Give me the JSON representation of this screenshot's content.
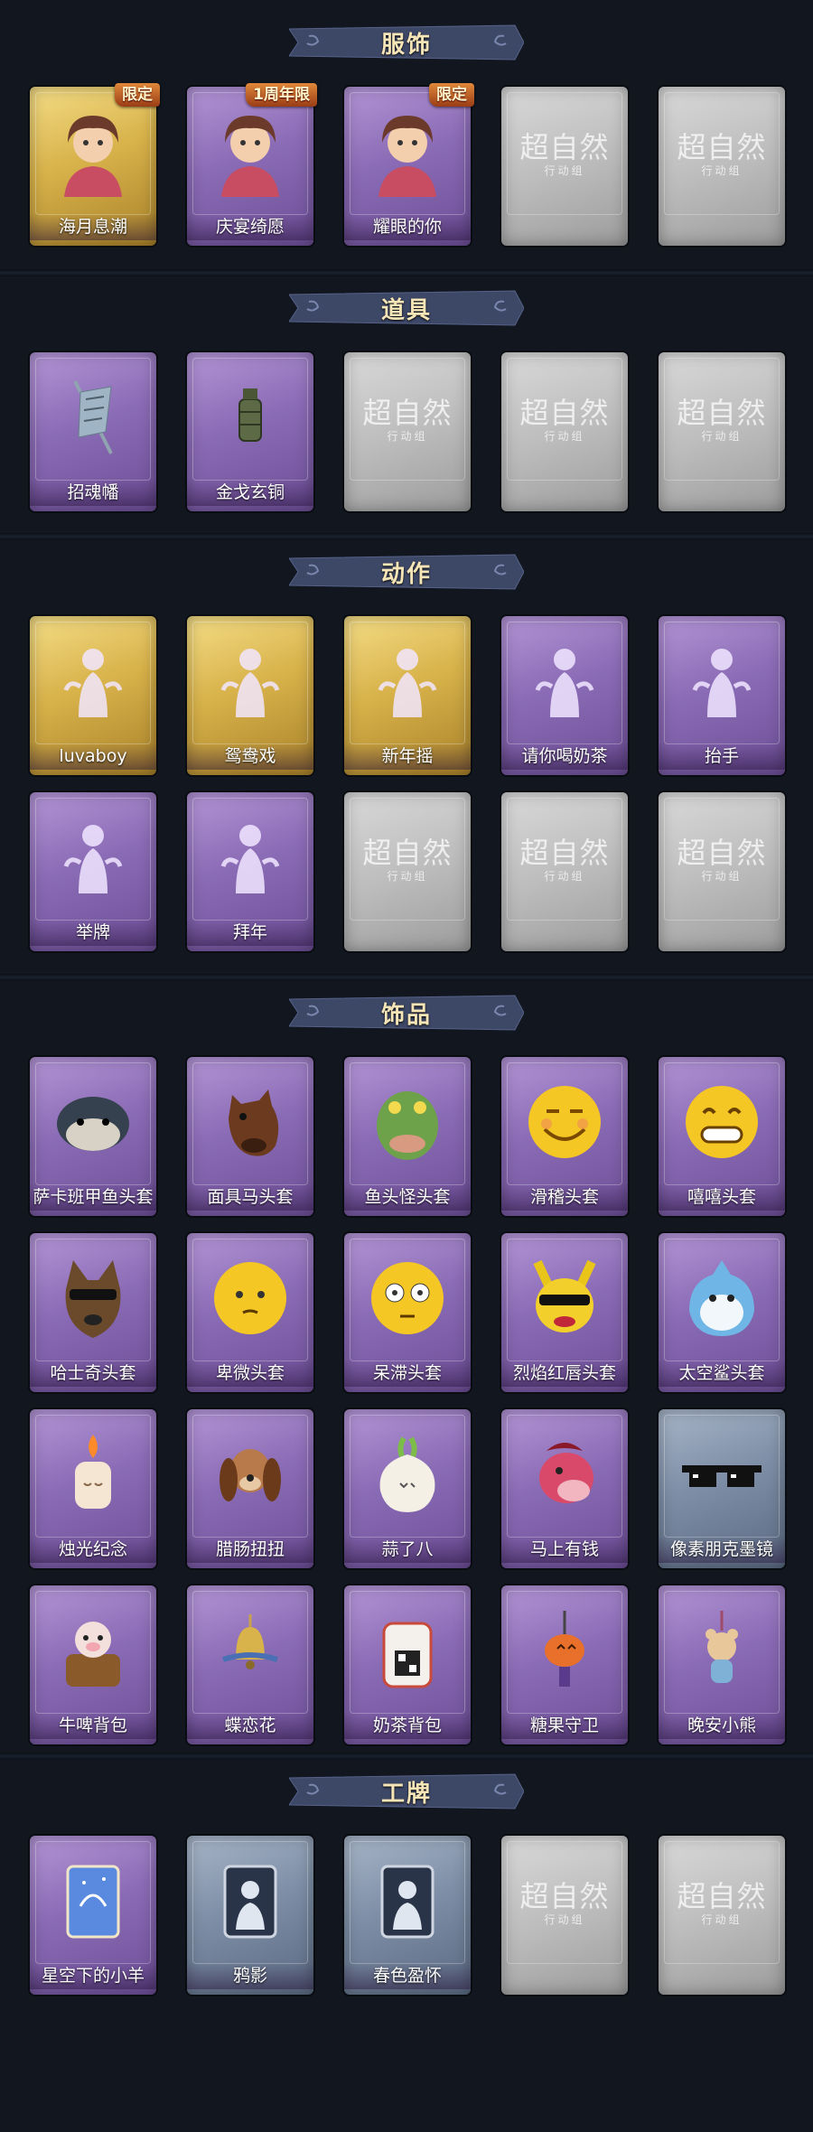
{
  "colors": {
    "background": "#11161f",
    "banner": "#3d4766",
    "banner_text": "#f6e6b7",
    "purple_frame": "#8a6bb5",
    "gold_frame": "#d8b24a",
    "blue_frame": "#7e8ea6",
    "grey_frame": "#bdbdbd",
    "badge": "#c2602a"
  },
  "placeholder": {
    "title": "超自然",
    "subtitle": "行动组"
  },
  "sections": [
    {
      "title": "服饰",
      "items": [
        {
          "label": "海月息潮",
          "style": "gold",
          "badge": "限定",
          "icon": "character-portrait-icon"
        },
        {
          "label": "庆宴绮愿",
          "style": "purple",
          "badge": "1周年限",
          "icon": "character-portrait-icon"
        },
        {
          "label": "耀眼的你",
          "style": "purple",
          "badge": "限定",
          "icon": "character-portrait-icon"
        },
        {
          "label": "",
          "style": "grey",
          "icon": "placeholder-logo-icon"
        },
        {
          "label": "",
          "style": "grey",
          "icon": "placeholder-logo-icon"
        }
      ]
    },
    {
      "title": "道具",
      "items": [
        {
          "label": "招魂幡",
          "style": "purple",
          "icon": "banner-prop-icon"
        },
        {
          "label": "金戈玄铜",
          "style": "purple",
          "icon": "bronze-lantern-icon"
        },
        {
          "label": "",
          "style": "grey",
          "icon": "placeholder-logo-icon"
        },
        {
          "label": "",
          "style": "grey",
          "icon": "placeholder-logo-icon"
        },
        {
          "label": "",
          "style": "grey",
          "icon": "placeholder-logo-icon"
        }
      ]
    },
    {
      "title": "动作",
      "items": [
        {
          "label": "luvaboy",
          "style": "gold",
          "icon": "pose-figure-icon"
        },
        {
          "label": "鸳鸯戏",
          "style": "gold",
          "icon": "pose-figure-icon"
        },
        {
          "label": "新年摇",
          "style": "gold",
          "icon": "pose-figure-icon"
        },
        {
          "label": "请你喝奶茶",
          "style": "purple",
          "icon": "pose-figure-icon"
        },
        {
          "label": "抬手",
          "style": "purple",
          "icon": "pose-figure-icon"
        },
        {
          "label": "举牌",
          "style": "purple",
          "icon": "pose-figure-icon"
        },
        {
          "label": "拜年",
          "style": "purple",
          "icon": "pose-figure-icon"
        },
        {
          "label": "",
          "style": "grey",
          "icon": "placeholder-logo-icon"
        },
        {
          "label": "",
          "style": "grey",
          "icon": "placeholder-logo-icon"
        },
        {
          "label": "",
          "style": "grey",
          "icon": "placeholder-logo-icon"
        }
      ]
    },
    {
      "title": "饰品",
      "items": [
        {
          "label": "萨卡班甲鱼头套",
          "style": "purple",
          "icon": "fish-head-icon"
        },
        {
          "label": "面具马头套",
          "style": "purple",
          "icon": "horse-head-icon"
        },
        {
          "label": "鱼头怪头套",
          "style": "purple",
          "icon": "frog-fish-head-icon"
        },
        {
          "label": "滑稽头套",
          "style": "purple",
          "icon": "smiley-face-icon"
        },
        {
          "label": "嘻嘻头套",
          "style": "purple",
          "icon": "grin-face-icon"
        },
        {
          "label": "哈士奇头套",
          "style": "purple",
          "icon": "husky-head-icon"
        },
        {
          "label": "卑微头套",
          "style": "purple",
          "icon": "humble-face-icon"
        },
        {
          "label": "呆滞头套",
          "style": "purple",
          "icon": "dazed-face-icon"
        },
        {
          "label": "烈焰红唇头套",
          "style": "purple",
          "icon": "pikachu-head-icon"
        },
        {
          "label": "太空鲨头套",
          "style": "purple",
          "icon": "shark-head-icon"
        },
        {
          "label": "烛光纪念",
          "style": "purple",
          "icon": "candle-icon"
        },
        {
          "label": "腊肠扭扭",
          "style": "purple",
          "icon": "dog-plush-icon"
        },
        {
          "label": "蒜了八",
          "style": "purple",
          "icon": "garlic-icon"
        },
        {
          "label": "马上有钱",
          "style": "purple",
          "icon": "pony-icon"
        },
        {
          "label": "像素朋克墨镜",
          "style": "blue",
          "icon": "pixel-sunglasses-icon"
        },
        {
          "label": "牛啤背包",
          "style": "purple",
          "icon": "cow-backpack-icon"
        },
        {
          "label": "蝶恋花",
          "style": "purple",
          "icon": "bell-charm-icon"
        },
        {
          "label": "奶茶背包",
          "style": "purple",
          "icon": "milk-tea-bag-icon"
        },
        {
          "label": "糖果守卫",
          "style": "purple",
          "icon": "pumpkin-charm-icon"
        },
        {
          "label": "晚安小熊",
          "style": "purple",
          "icon": "bear-charm-icon"
        }
      ]
    },
    {
      "title": "工牌",
      "items": [
        {
          "label": "星空下的小羊",
          "style": "purple",
          "icon": "starry-card-icon"
        },
        {
          "label": "鸦影",
          "style": "blue",
          "icon": "silhouette-card-icon"
        },
        {
          "label": "春色盈怀",
          "style": "blue",
          "icon": "silhouette-card-icon"
        },
        {
          "label": "",
          "style": "grey",
          "icon": "placeholder-logo-icon"
        },
        {
          "label": "",
          "style": "grey",
          "icon": "placeholder-logo-icon"
        }
      ]
    }
  ]
}
